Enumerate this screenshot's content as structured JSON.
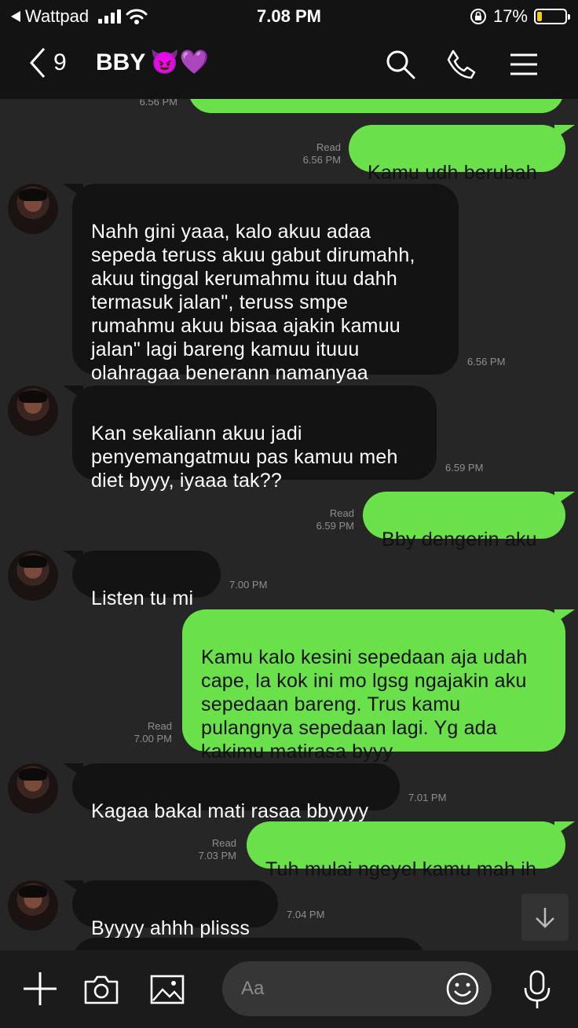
{
  "status_bar": {
    "back_app": "Wattpad",
    "time": "7.08 PM",
    "battery_percent": "17%",
    "battery_level": 0.17,
    "battery_color": "#f2cc18"
  },
  "header": {
    "back_count": "9",
    "title": "BBY",
    "title_emojis": "😈💜",
    "icons": [
      "search-icon",
      "phone-icon",
      "menu-icon"
    ]
  },
  "messages": [
    {
      "dir": "out",
      "text": "",
      "read": "",
      "time": "6.56 PM"
    },
    {
      "dir": "out",
      "text": "Kamu udh berubah",
      "read": "Read",
      "time": "6.56 PM"
    },
    {
      "dir": "in",
      "text": "Nahh gini yaaa, kalo akuu adaa\nsepeda teruss akuu gabut dirumahh,\nakuu tinggal kerumahmu ituu dahh\ntermasuk jalan\", teruss smpe\nrumahmu akuu bisaa ajakin kamuu\njalan\" lagi bareng kamuu ituuu\nolahragaa benerann namanyaa",
      "time": "6.56 PM"
    },
    {
      "dir": "in",
      "text": "Kan sekaliann akuu jadi\npenyemangatmuu pas kamuu meh\ndiet byyy, iyaaa tak??",
      "time": "6.59 PM"
    },
    {
      "dir": "out",
      "text": "Bby dengerin aku",
      "read": "Read",
      "time": "6.59 PM"
    },
    {
      "dir": "in",
      "text": "Listen tu mi",
      "time": "7.00 PM"
    },
    {
      "dir": "out",
      "text": "Kamu kalo kesini sepedaan aja udah\ncape, la kok ini mo lgsg ngajakin aku\nsepedaan bareng. Trus kamu\npulangnya sepedaan lagi. Yg ada\nkakimu matirasa byyy",
      "read": "Read",
      "time": "7.00 PM"
    },
    {
      "dir": "in",
      "text": "Kagaa bakal mati rasaa bbyyyy",
      "time": "7.01 PM"
    },
    {
      "dir": "out",
      "text": "Tuh mulai ngeyel kamu mah ih",
      "read": "Read",
      "time": "7.03 PM"
    },
    {
      "dir": "in",
      "text": "Byyyy ahhh plisss",
      "time": "7.04 PM"
    }
  ],
  "composer": {
    "placeholder": "Aa",
    "icons": [
      "plus-icon",
      "camera-icon",
      "image-icon",
      "emoji-icon",
      "microphone-icon"
    ]
  },
  "colors": {
    "outgoing_bubble": "#6ae04a",
    "incoming_bubble": "#131313",
    "background": "#262626"
  }
}
